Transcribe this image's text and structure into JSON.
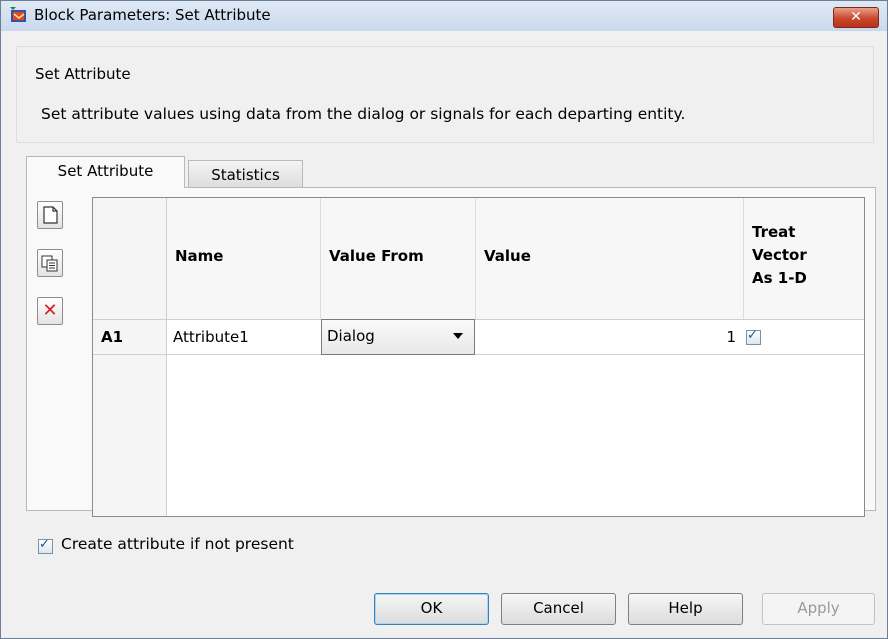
{
  "window": {
    "title": "Block Parameters: Set Attribute",
    "close_glyph": "✕"
  },
  "group": {
    "legend": "Set Attribute",
    "description": "Set attribute values using data from the dialog or signals for each departing entity."
  },
  "tabs": [
    {
      "label": "Set Attribute",
      "active": true
    },
    {
      "label": "Statistics",
      "active": false
    }
  ],
  "toolbar": {
    "icons": [
      "new-row-icon",
      "copy-row-icon",
      "delete-row-icon"
    ],
    "delete_glyph": "✕"
  },
  "table": {
    "headers": {
      "name": "Name",
      "value_from": "Value From",
      "value": "Value",
      "treat_line1": "Treat",
      "treat_line2": "Vector",
      "treat_line3": "As 1-D"
    },
    "rows": [
      {
        "id": "A1",
        "name": "Attribute1",
        "value_from": "Dialog",
        "value": "1",
        "treat_vector_checked": true
      }
    ]
  },
  "options": {
    "create_attribute_label": "Create attribute if not present",
    "create_attribute_checked": true
  },
  "buttons": {
    "ok": "OK",
    "cancel": "Cancel",
    "help": "Help",
    "apply": "Apply"
  },
  "colors": {
    "title_gradient_top": "#dfe9f5",
    "close_red": "#c8472e",
    "delete_red": "#d81e1e"
  }
}
